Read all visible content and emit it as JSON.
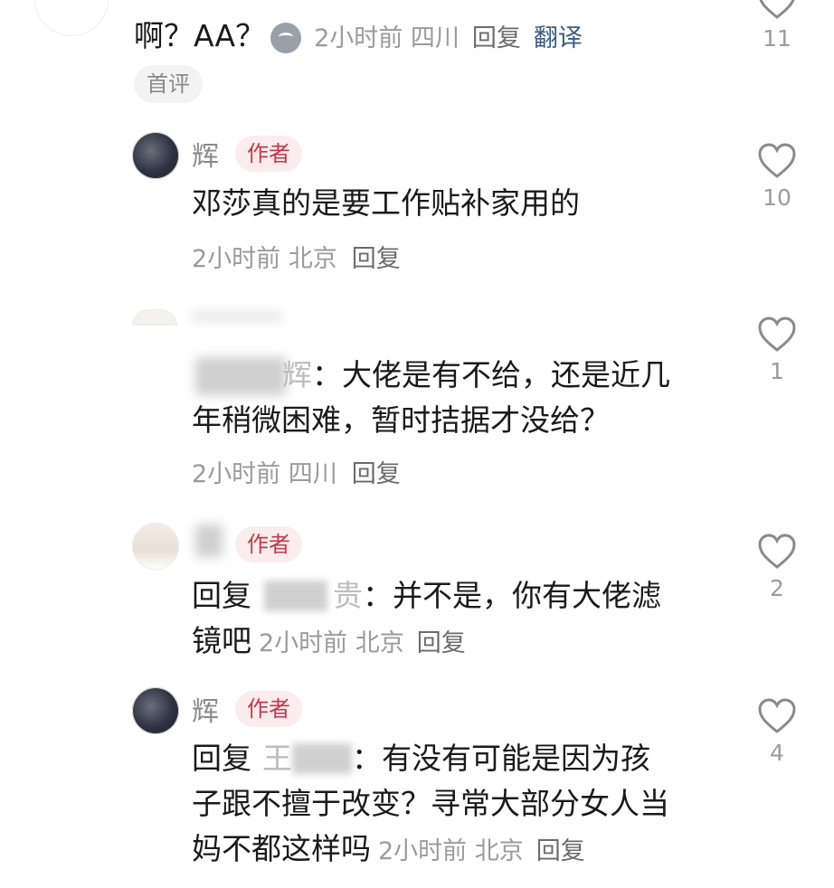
{
  "comments": [
    {
      "text_pre": "啊？AA？",
      "emoji": "ghost-emoji",
      "time": "2小时前",
      "location": "四川",
      "reply": "回复",
      "translate": "翻译",
      "likes": "11",
      "tag": "首评"
    },
    {
      "name": "辉",
      "badge": "作者",
      "text": "邓莎真的是要工作贴补家用的",
      "time": "2小时前",
      "location": "北京",
      "reply": "回复",
      "likes": "10"
    },
    {
      "name_tail": "辉",
      "text_line1": "：大佬是有不给，还是近几",
      "text_line2": "年稍微困难，暂时拮据才没给？",
      "time": "2小时前",
      "location": "四川",
      "reply": "回复",
      "likes": "1"
    },
    {
      "badge": "作者",
      "reply_prefix": "回复",
      "target_tail": "贵",
      "text_line1": "：并不是，你有大佬滤",
      "text_line2": "镜吧",
      "time": "2小时前",
      "location": "北京",
      "reply": "回复",
      "likes": "2"
    },
    {
      "name": "辉",
      "badge": "作者",
      "reply_prefix": "回复",
      "target_head": "王",
      "text_line1": "：有没有可能是因为孩",
      "text_line2": "子跟不擅于改变？寻常大部分女人当",
      "text_line3": "妈不都这样吗",
      "time": "2小时前",
      "location": "北京",
      "reply": "回复",
      "likes": "4"
    }
  ],
  "colors": {
    "author_badge_bg": "#fbecee",
    "author_badge_text": "#c0394a",
    "translate": "#3b5a86"
  }
}
